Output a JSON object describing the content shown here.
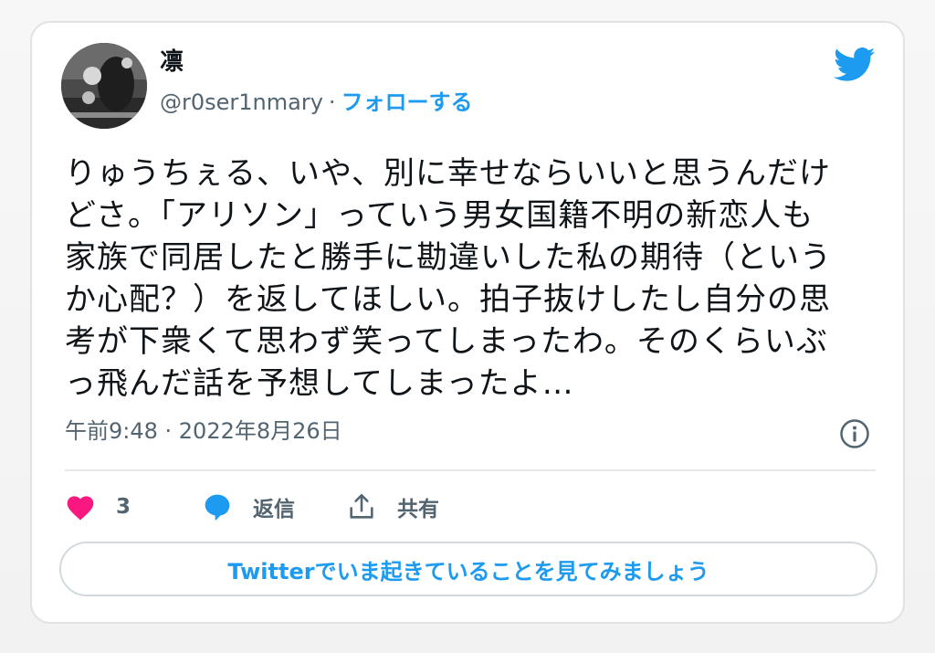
{
  "author": {
    "display_name": "凛",
    "handle": "@r0ser1nmary",
    "separator": "·",
    "follow_label": "フォローする"
  },
  "tweet": {
    "lines": [
      "りゅうちぇる、いや、別に幸せならいいと思うんだけ",
      "どさ。「アリソン」っていう男女国籍不明の新恋人も",
      "家族で同居したと勝手に勘違いした私の期待（という",
      "か心配？）を返してほしい。拍子抜けしたし自分の思",
      "考が下衆くて思わず笑ってしまったわ。そのくらいぶ",
      "っ飛んだ話を予想してしまったよ…"
    ],
    "timestamp": "午前9:48 · 2022年8月26日"
  },
  "actions": {
    "like_count": "3",
    "reply_label": "返信",
    "share_label": "共有"
  },
  "cta": {
    "label": "Twitterでいま起きていることを見てみましょう"
  },
  "colors": {
    "accent": "#1d9bf0",
    "like": "#f91880",
    "muted": "#536471",
    "text": "#0f1419"
  },
  "icons": {
    "brand": "twitter-bird-icon",
    "info": "info-icon",
    "like": "heart-icon",
    "reply": "speech-bubble-icon",
    "share": "share-icon"
  }
}
